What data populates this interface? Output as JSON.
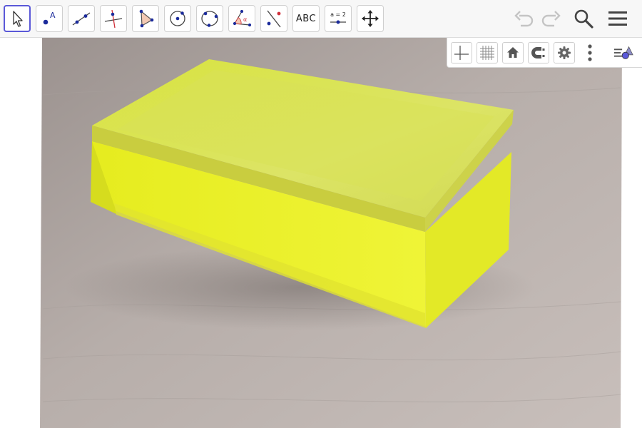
{
  "toolbar": {
    "tools": [
      {
        "id": "move",
        "icon": "cursor-arrow-icon"
      },
      {
        "id": "point",
        "icon": "point-icon",
        "label": "A"
      },
      {
        "id": "line",
        "icon": "line-through-points-icon"
      },
      {
        "id": "perpendicular",
        "icon": "perpendicular-line-icon"
      },
      {
        "id": "polygon",
        "icon": "polygon-icon"
      },
      {
        "id": "circle",
        "icon": "circle-center-point-icon"
      },
      {
        "id": "circle-three",
        "icon": "circle-three-points-icon"
      },
      {
        "id": "angle",
        "icon": "angle-icon",
        "label": "α"
      },
      {
        "id": "reflect",
        "icon": "reflect-line-icon"
      },
      {
        "id": "text",
        "icon": "text-icon",
        "label": "ABC"
      },
      {
        "id": "slider",
        "icon": "slider-icon",
        "label": "a = 2"
      },
      {
        "id": "move-view",
        "icon": "move-graphics-view-icon"
      }
    ],
    "right": [
      "undo-icon",
      "redo-icon",
      "search-icon",
      "menu-icon"
    ]
  },
  "stylebar": {
    "buttons": [
      "axes-icon",
      "grid-icon",
      "home-icon",
      "point-capturing-icon",
      "settings-gear-icon",
      "more-vert-icon",
      "toggle-style-bar-icon"
    ]
  },
  "colors": {
    "accent": "#5a58d8",
    "point": "#1b2b9b",
    "box_yellow": "#e9ef2a",
    "table": "#b9b1ac"
  }
}
